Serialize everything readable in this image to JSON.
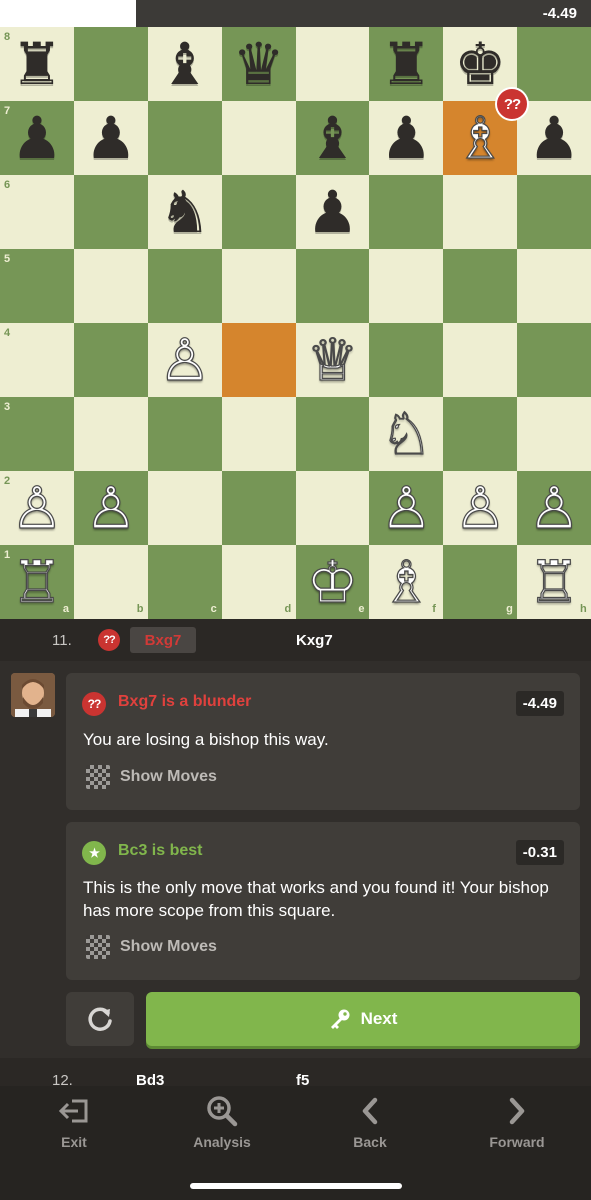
{
  "eval_bar": {
    "value": "-4.49",
    "white_fraction": 0.23
  },
  "board": {
    "ranks": [
      "8",
      "7",
      "6",
      "5",
      "4",
      "3",
      "2",
      "1"
    ],
    "files": [
      "a",
      "b",
      "c",
      "d",
      "e",
      "f",
      "g",
      "h"
    ],
    "colors": {
      "light": "#eeeed2",
      "dark": "#769656",
      "highlight": "#d5852d"
    },
    "highlighted_squares": [
      "g7",
      "d4"
    ],
    "pieces": [
      {
        "sq": "a8",
        "glyph": "♜",
        "color": "black",
        "name": "black-rook"
      },
      {
        "sq": "c8",
        "glyph": "♝",
        "color": "black",
        "name": "black-bishop"
      },
      {
        "sq": "d8",
        "glyph": "♛",
        "color": "black",
        "name": "black-queen"
      },
      {
        "sq": "f8",
        "glyph": "♜",
        "color": "black",
        "name": "black-rook"
      },
      {
        "sq": "g8",
        "glyph": "♚",
        "color": "black",
        "name": "black-king"
      },
      {
        "sq": "a7",
        "glyph": "♟",
        "color": "black",
        "name": "black-pawn"
      },
      {
        "sq": "b7",
        "glyph": "♟",
        "color": "black",
        "name": "black-pawn"
      },
      {
        "sq": "e7",
        "glyph": "♝",
        "color": "black",
        "name": "black-bishop"
      },
      {
        "sq": "f7",
        "glyph": "♟",
        "color": "black",
        "name": "black-pawn"
      },
      {
        "sq": "g7",
        "glyph": "♗",
        "color": "white",
        "name": "white-bishop"
      },
      {
        "sq": "h7",
        "glyph": "♟",
        "color": "black",
        "name": "black-pawn"
      },
      {
        "sq": "c6",
        "glyph": "♞",
        "color": "black",
        "name": "black-knight"
      },
      {
        "sq": "e6",
        "glyph": "♟",
        "color": "black",
        "name": "black-pawn"
      },
      {
        "sq": "c4",
        "glyph": "♙",
        "color": "white",
        "name": "white-pawn"
      },
      {
        "sq": "e4",
        "glyph": "♕",
        "color": "white",
        "name": "white-queen"
      },
      {
        "sq": "f3",
        "glyph": "♘",
        "color": "white",
        "name": "white-knight"
      },
      {
        "sq": "a2",
        "glyph": "♙",
        "color": "white",
        "name": "white-pawn"
      },
      {
        "sq": "b2",
        "glyph": "♙",
        "color": "white",
        "name": "white-pawn"
      },
      {
        "sq": "f2",
        "glyph": "♙",
        "color": "white",
        "name": "white-pawn"
      },
      {
        "sq": "g2",
        "glyph": "♙",
        "color": "white",
        "name": "white-pawn"
      },
      {
        "sq": "h2",
        "glyph": "♙",
        "color": "white",
        "name": "white-pawn"
      },
      {
        "sq": "a1",
        "glyph": "♖",
        "color": "white",
        "name": "white-rook"
      },
      {
        "sq": "e1",
        "glyph": "♔",
        "color": "white",
        "name": "white-king"
      },
      {
        "sq": "f1",
        "glyph": "♗",
        "color": "white",
        "name": "white-bishop"
      },
      {
        "sq": "h1",
        "glyph": "♖",
        "color": "white",
        "name": "white-rook"
      }
    ],
    "blunder_badge": "??"
  },
  "move_row": {
    "number": "11.",
    "white_move": "Bxg7",
    "black_move": "Kxg7",
    "badge": "??"
  },
  "cards": [
    {
      "icon": "??",
      "icon_color": "#ca3431",
      "title": "Bxg7 is a blunder",
      "title_color": "#e0413d",
      "score": "-4.49",
      "description": "You are losing a bishop this way.",
      "show_moves": "Show Moves"
    },
    {
      "icon": "★",
      "icon_color": "#81b64c",
      "title": "Bc3 is best",
      "title_color": "#81b64c",
      "score": "-0.31",
      "description": "This is the only move that works and you found it! Your bishop has more scope from this square.",
      "show_moves": "Show Moves"
    }
  ],
  "buttons": {
    "next_label": "Next"
  },
  "next_move_row": {
    "number": "12.",
    "white_move": "Bd3",
    "black_move": "f5"
  },
  "bottom_nav": [
    {
      "label": "Exit",
      "icon": "exit-icon"
    },
    {
      "label": "Analysis",
      "icon": "analysis-icon"
    },
    {
      "label": "Back",
      "icon": "chevron-left-icon"
    },
    {
      "label": "Forward",
      "icon": "chevron-right-icon"
    }
  ]
}
